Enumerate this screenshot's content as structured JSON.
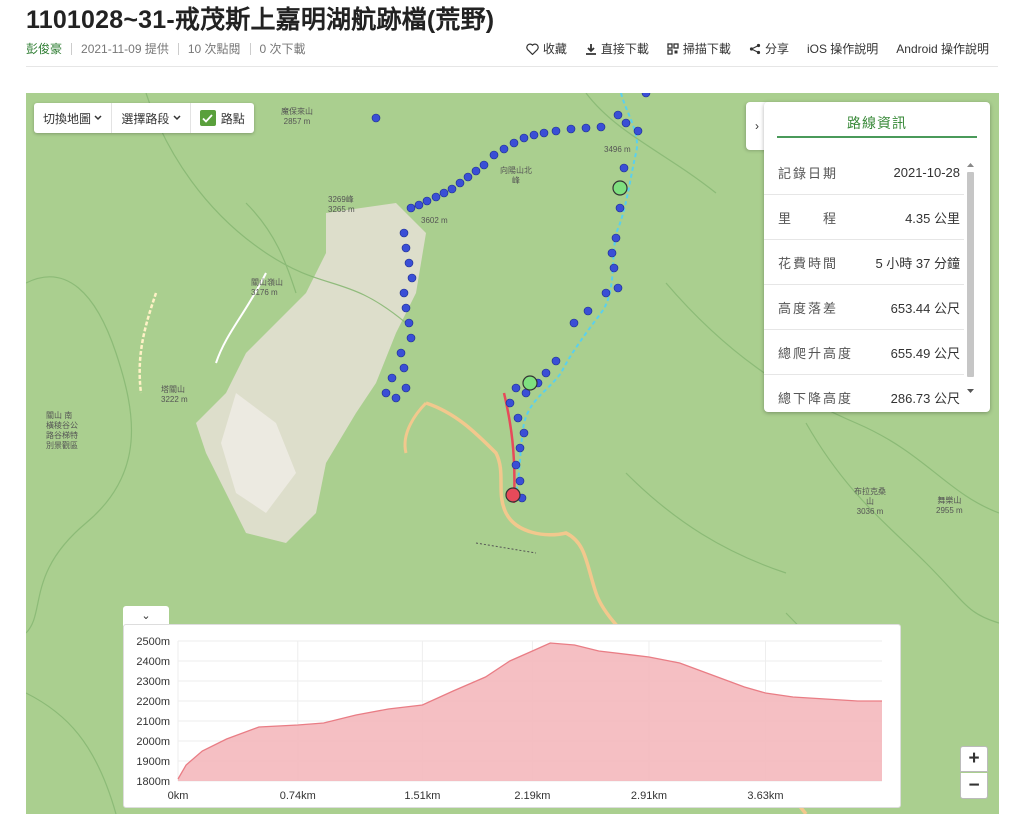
{
  "title": "1101028~31-戒茂斯上嘉明湖航跡檔(荒野)",
  "meta": {
    "author": "彭俊豪",
    "date": "2021-11-09 提供",
    "clicks": "10 次點閱",
    "downloads": "0 次下載"
  },
  "actions": {
    "favorite": "收藏",
    "download": "直接下載",
    "scan": "掃描下載",
    "share": "分享",
    "ios_help": "iOS 操作說明",
    "android_help": "Android 操作說明"
  },
  "map_controls": {
    "switch_map": "切換地圖",
    "select_route": "選擇路段",
    "waypoints": "路點",
    "expand_panel": "›",
    "collapse_chart": "⌄",
    "zoom_in": "+",
    "zoom_out": "−"
  },
  "info": {
    "title": "路線資訊",
    "rows": [
      {
        "label": "記錄日期",
        "value": "2021-10-28"
      },
      {
        "label": "里　　程",
        "value": "4.35 公里"
      },
      {
        "label": "花費時間",
        "value": "5 小時 37 分鐘"
      },
      {
        "label": "高度落差",
        "value": "653.44 公尺"
      },
      {
        "label": "總爬升高度",
        "value": "655.49 公尺"
      },
      {
        "label": "總下降高度",
        "value": "286.73 公尺"
      }
    ]
  },
  "map_labels": [
    {
      "text": "魔保來山"
    },
    {
      "text": "2857 m"
    },
    {
      "text": "3496 m"
    },
    {
      "text": "3269峰"
    },
    {
      "text": "3265 m"
    },
    {
      "text": "3602 m"
    },
    {
      "text": "關山嶺山"
    },
    {
      "text": "3176 m"
    },
    {
      "text": "塔關山"
    },
    {
      "text": "3222 m"
    },
    {
      "text": "關山 南"
    },
    {
      "text": "橫稜谷公"
    },
    {
      "text": "路谷梯特"
    },
    {
      "text": "別景觀區"
    },
    {
      "text": "布拉克桑"
    },
    {
      "text": "山"
    },
    {
      "text": "3036 m"
    },
    {
      "text": "舞樂山"
    },
    {
      "text": "2955 m"
    },
    {
      "text": "向陽山北"
    },
    {
      "text": "峰"
    }
  ],
  "chart_data": {
    "type": "area",
    "title": "",
    "xlabel": "",
    "ylabel": "",
    "x_ticks": [
      "0km",
      "0.74km",
      "1.51km",
      "2.19km",
      "2.91km",
      "3.63km"
    ],
    "y_ticks": [
      "2500m",
      "2400m",
      "2300m",
      "2200m",
      "2100m",
      "2000m",
      "1900m",
      "1800m"
    ],
    "ylim": [
      1800,
      2500
    ],
    "xlim": [
      0,
      4.35
    ],
    "x": [
      0,
      0.05,
      0.15,
      0.3,
      0.5,
      0.74,
      0.9,
      1.1,
      1.3,
      1.51,
      1.7,
      1.9,
      2.05,
      2.19,
      2.3,
      2.45,
      2.6,
      2.91,
      3.1,
      3.3,
      3.5,
      3.63,
      3.8,
      4.0,
      4.2,
      4.35
    ],
    "values": [
      1810,
      1880,
      1950,
      2010,
      2070,
      2080,
      2090,
      2130,
      2160,
      2180,
      2250,
      2320,
      2400,
      2450,
      2490,
      2480,
      2450,
      2420,
      2390,
      2330,
      2270,
      2240,
      2220,
      2210,
      2200,
      2200
    ],
    "fill_color": "#f4b8bc",
    "line_color": "#e97d85",
    "grid": true
  }
}
